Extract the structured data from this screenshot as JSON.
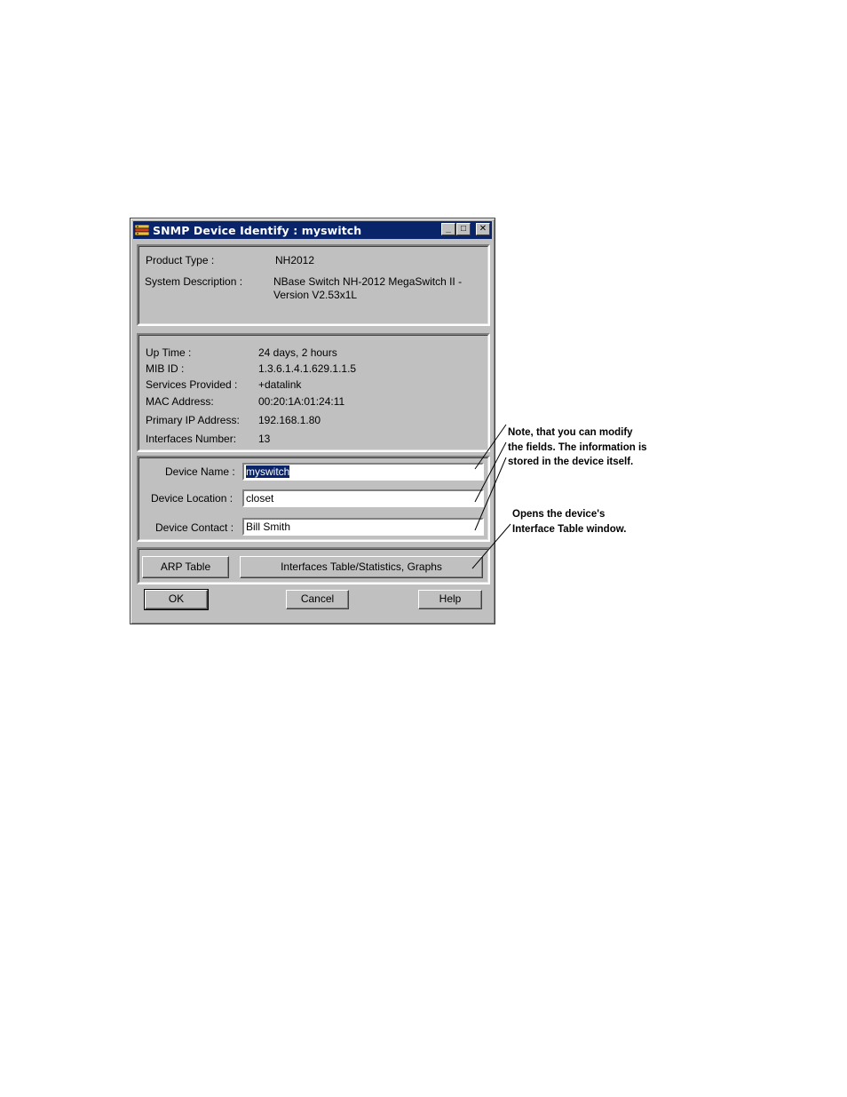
{
  "window": {
    "title": "SNMP Device Identify : myswitch",
    "minimize": "_",
    "maximize": "□",
    "close": "✕"
  },
  "product": {
    "type_label": "Product Type :",
    "type_value": "NH2012",
    "desc_label": "System Description :",
    "desc_line1": "NBase Switch NH-2012 MegaSwitch II -",
    "desc_line2": "Version V2.53x1L"
  },
  "info": [
    {
      "label": "Up Time :",
      "value": "24 days, 2 hours"
    },
    {
      "label": "MIB ID :",
      "value": "1.3.6.1.4.1.629.1.1.5"
    },
    {
      "label": "Services Provided :",
      "value": "+datalink"
    },
    {
      "label": "MAC Address:",
      "value": "00:20:1A:01:24:11"
    },
    {
      "label": "Primary IP Address:",
      "value": "192.168.1.80"
    },
    {
      "label": "Interfaces Number:",
      "value": "13"
    }
  ],
  "fields": {
    "name_label": "Device Name :",
    "name_value": "myswitch",
    "location_label": "Device Location :",
    "location_value": "closet",
    "contact_label": "Device Contact :",
    "contact_value": "Bill Smith"
  },
  "buttons": {
    "arp": "ARP Table",
    "interfaces": "Interfaces Table/Statistics, Graphs",
    "ok": "OK",
    "cancel": "Cancel",
    "help": "Help"
  },
  "notes": {
    "fields_line1": "Note, that you can modify",
    "fields_line2": "the fields. The information is",
    "fields_line3": "stored in the device itself.",
    "interfaces_line1": "Opens the device's",
    "interfaces_line2": "Interface Table window."
  },
  "colors": {
    "titlebar": "#0a246a",
    "face": "#c0c0c0",
    "selection": "#0a246a"
  }
}
